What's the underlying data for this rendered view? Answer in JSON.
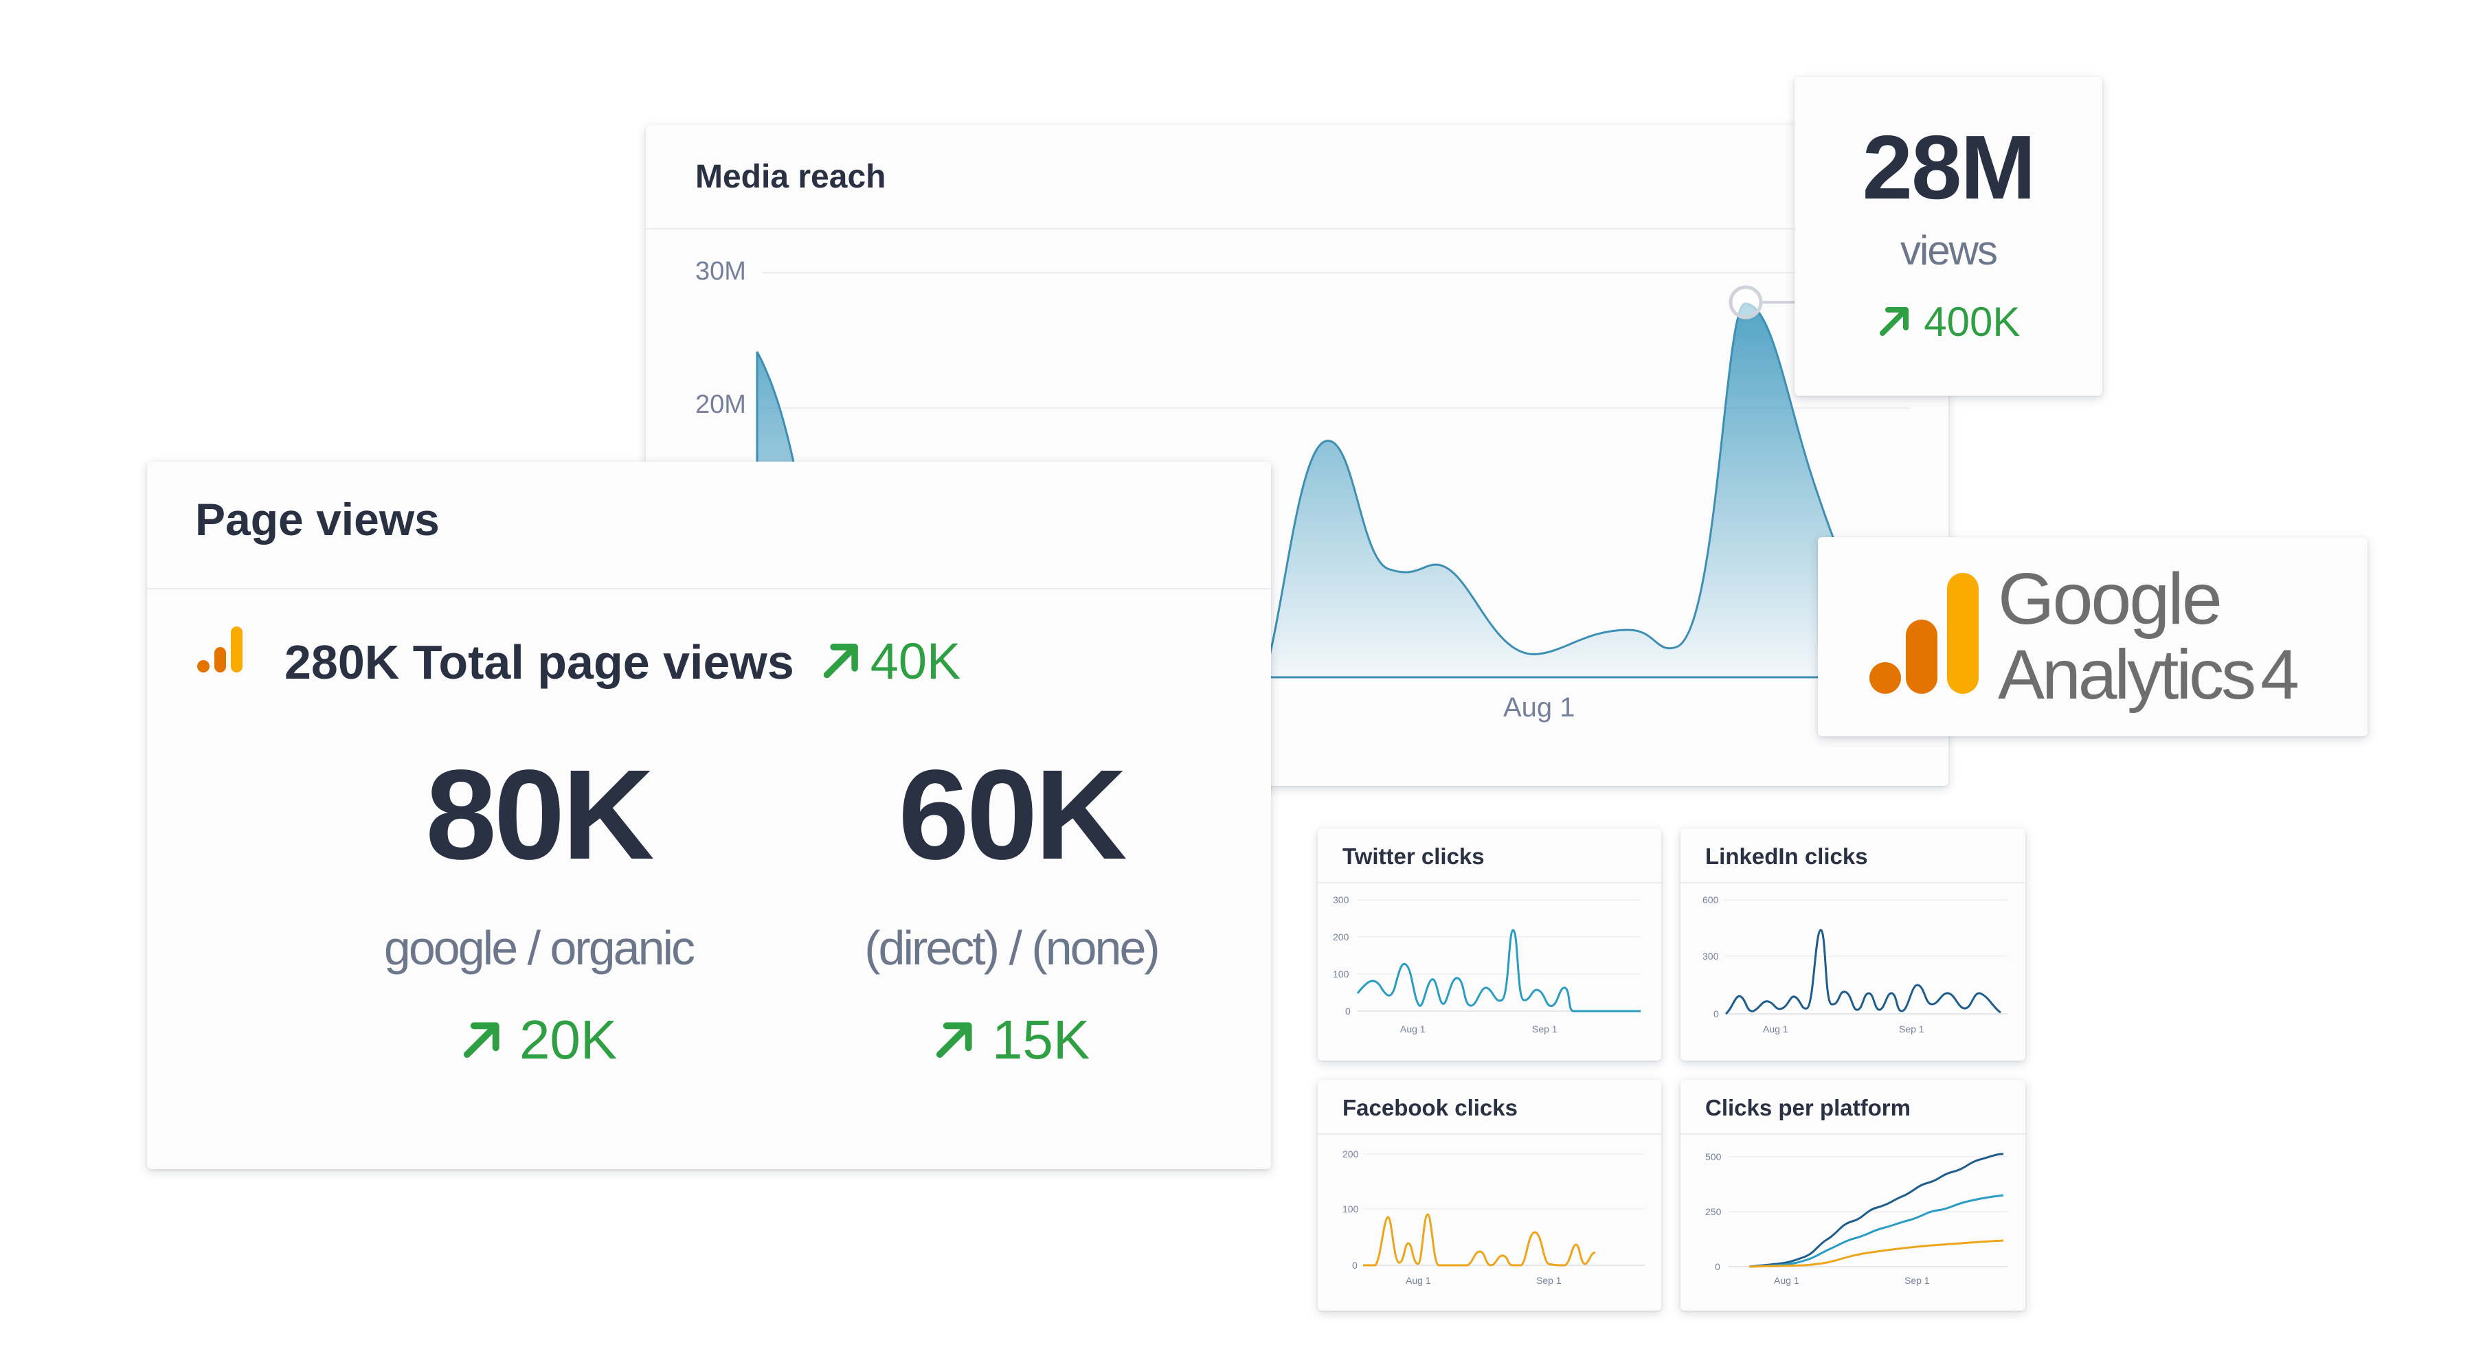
{
  "media_reach": {
    "title": "Media reach",
    "y_labels": [
      "30M",
      "20M"
    ],
    "x_label": "Aug 1",
    "color": "#3e8fb3"
  },
  "highlight": {
    "value": "28M",
    "unit": "views",
    "delta": "400K",
    "delta_icon": "arrow-up-right-icon"
  },
  "ga4": {
    "word1": "Google",
    "word2": "Analytics",
    "version": "4",
    "colors": [
      "#f9ab00",
      "#e37400"
    ]
  },
  "page_views": {
    "title": "Page views",
    "total_label": "280K Total page views",
    "total_delta": "40K",
    "icon": "analytics-bars-icon",
    "metrics": [
      {
        "value": "80K",
        "label": "google / organic",
        "delta": "20K"
      },
      {
        "value": "60K",
        "label": "(direct) / (none)",
        "delta": "15K"
      }
    ]
  },
  "mini_charts": [
    {
      "title": "Twitter clicks",
      "y_labels": [
        "300",
        "200",
        "100",
        "0"
      ],
      "x_labels": [
        "Aug 1",
        "Sep 1"
      ],
      "color": "#2b9cc2"
    },
    {
      "title": "LinkedIn clicks",
      "y_labels": [
        "600",
        "300",
        "0"
      ],
      "x_labels": [
        "Aug 1",
        "Sep 1"
      ],
      "color": "#1f5d8c"
    },
    {
      "title": "Facebook clicks",
      "y_labels": [
        "200",
        "100",
        "0"
      ],
      "x_labels": [
        "Aug 1",
        "Sep 1"
      ],
      "color": "#eda51c"
    },
    {
      "title": "Clicks per platform",
      "y_labels": [
        "500",
        "250",
        "0"
      ],
      "x_labels": [
        "Aug 1",
        "Sep 1"
      ],
      "colors": [
        "#1f5d8c",
        "#2b9cc2",
        "#eda51c"
      ]
    }
  ]
}
